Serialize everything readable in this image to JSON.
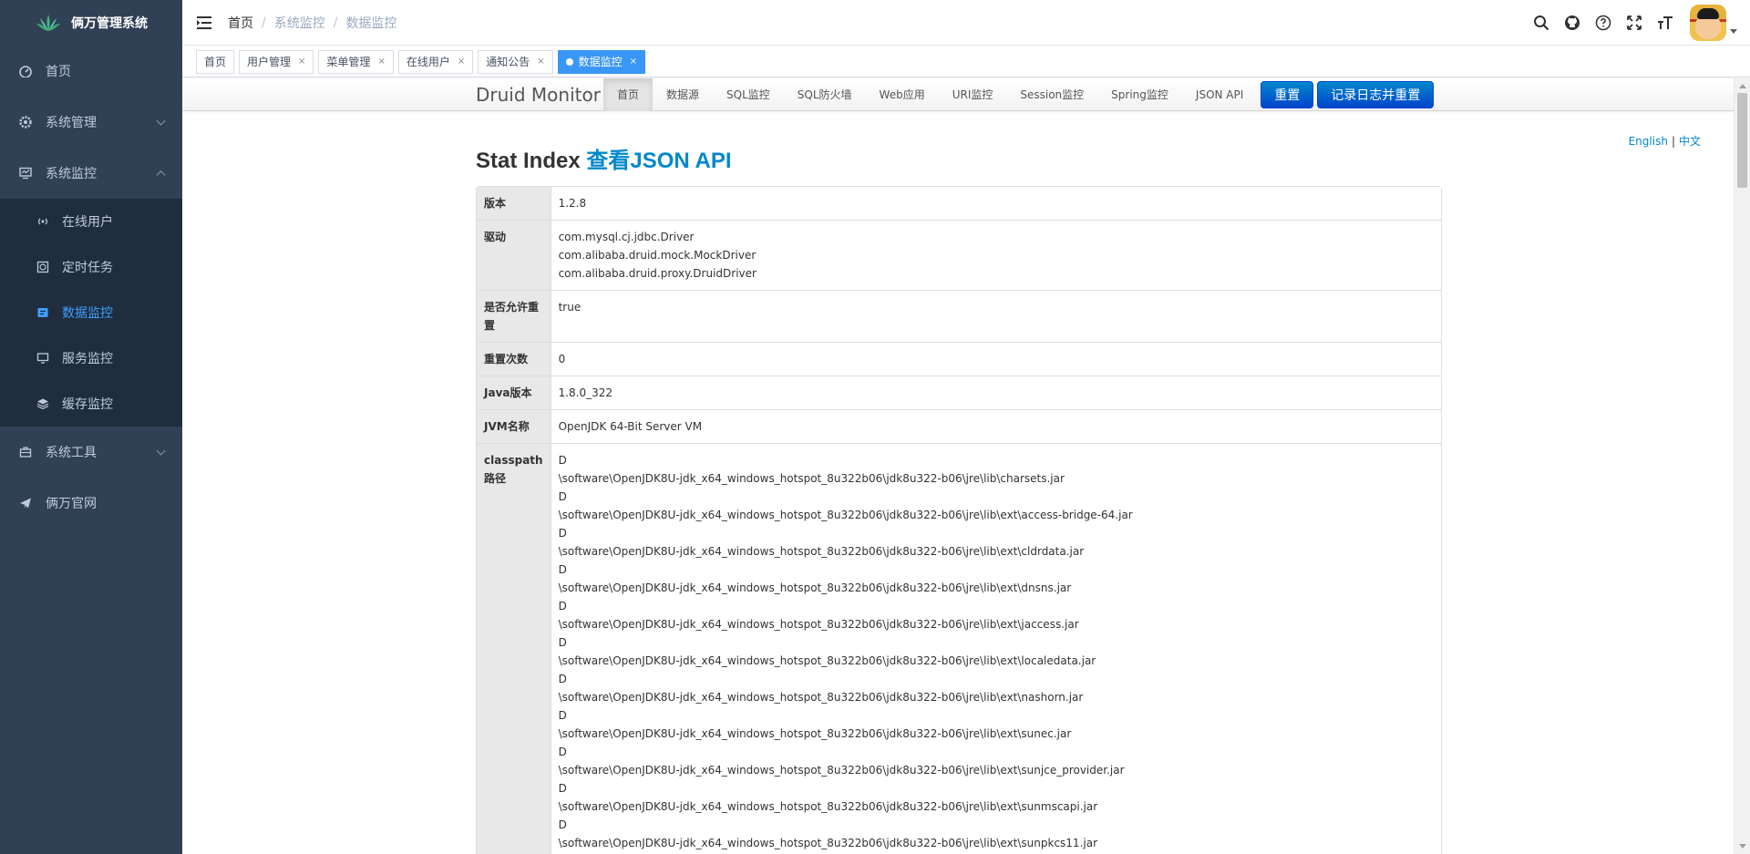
{
  "sidebar": {
    "logo_text": "俩万管理系统",
    "menu": [
      {
        "label": "首页",
        "icon": "dashboard-icon"
      },
      {
        "label": "系统管理",
        "icon": "gear-icon"
      },
      {
        "label": "系统监控",
        "icon": "monitor-icon"
      },
      {
        "label": "系统工具",
        "icon": "toolbox-icon"
      },
      {
        "label": "俩万官网",
        "icon": "paper-plane-icon"
      }
    ],
    "monitor_sub": [
      {
        "label": "在线用户",
        "icon": "online-icon"
      },
      {
        "label": "定时任务",
        "icon": "job-icon"
      },
      {
        "label": "数据监控",
        "icon": "druid-icon",
        "active": true
      },
      {
        "label": "服务监控",
        "icon": "server-icon"
      },
      {
        "label": "缓存监控",
        "icon": "redis-icon"
      }
    ]
  },
  "navbar": {
    "breadcrumb": [
      "首页",
      "系统监控",
      "数据监控"
    ]
  },
  "tags": [
    {
      "label": "首页"
    },
    {
      "label": "用户管理"
    },
    {
      "label": "菜单管理"
    },
    {
      "label": "在线用户"
    },
    {
      "label": "通知公告"
    },
    {
      "label": "数据监控",
      "active": true
    }
  ],
  "druid": {
    "brand": "Druid Monitor",
    "nav": [
      "首页",
      "数据源",
      "SQL监控",
      "SQL防火墙",
      "Web应用",
      "URI监控",
      "Session监控",
      "Spring监控",
      "JSON API"
    ],
    "reset_btn": "重置",
    "log_reset_btn": "记录日志并重置",
    "lang_en": "English",
    "lang_sep": "|",
    "lang_zh": "中文",
    "heading": "Stat Index",
    "heading_link": "查看JSON API",
    "rows": [
      {
        "key": "版本",
        "values": [
          "1.2.8"
        ]
      },
      {
        "key": "驱动",
        "values": [
          "com.mysql.cj.jdbc.Driver",
          "com.alibaba.druid.mock.MockDriver",
          "com.alibaba.druid.proxy.DruidDriver"
        ]
      },
      {
        "key": "是否允许重置",
        "values": [
          "true"
        ]
      },
      {
        "key": "重置次数",
        "values": [
          "0"
        ]
      },
      {
        "key": "Java版本",
        "values": [
          "1.8.0_322"
        ]
      },
      {
        "key": "JVM名称",
        "values": [
          "OpenJDK 64-Bit Server VM"
        ]
      },
      {
        "key": "classpath路径",
        "values": [
          "D",
          "\\software\\OpenJDK8U-jdk_x64_windows_hotspot_8u322b06\\jdk8u322-b06\\jre\\lib\\charsets.jar",
          "D",
          "\\software\\OpenJDK8U-jdk_x64_windows_hotspot_8u322b06\\jdk8u322-b06\\jre\\lib\\ext\\access-bridge-64.jar",
          "D",
          "\\software\\OpenJDK8U-jdk_x64_windows_hotspot_8u322b06\\jdk8u322-b06\\jre\\lib\\ext\\cldrdata.jar",
          "D",
          "\\software\\OpenJDK8U-jdk_x64_windows_hotspot_8u322b06\\jdk8u322-b06\\jre\\lib\\ext\\dnsns.jar",
          "D",
          "\\software\\OpenJDK8U-jdk_x64_windows_hotspot_8u322b06\\jdk8u322-b06\\jre\\lib\\ext\\jaccess.jar",
          "D",
          "\\software\\OpenJDK8U-jdk_x64_windows_hotspot_8u322b06\\jdk8u322-b06\\jre\\lib\\ext\\localedata.jar",
          "D",
          "\\software\\OpenJDK8U-jdk_x64_windows_hotspot_8u322b06\\jdk8u322-b06\\jre\\lib\\ext\\nashorn.jar",
          "D",
          "\\software\\OpenJDK8U-jdk_x64_windows_hotspot_8u322b06\\jdk8u322-b06\\jre\\lib\\ext\\sunec.jar",
          "D",
          "\\software\\OpenJDK8U-jdk_x64_windows_hotspot_8u322b06\\jdk8u322-b06\\jre\\lib\\ext\\sunjce_provider.jar",
          "D",
          "\\software\\OpenJDK8U-jdk_x64_windows_hotspot_8u322b06\\jdk8u322-b06\\jre\\lib\\ext\\sunmscapi.jar",
          "D",
          "\\software\\OpenJDK8U-jdk_x64_windows_hotspot_8u322b06\\jdk8u322-b06\\jre\\lib\\ext\\sunpkcs11.jar"
        ]
      }
    ]
  },
  "colors": {
    "sidebar_bg": "#304156",
    "submenu_bg": "#1f2d3d",
    "active_blue": "#409eff",
    "link_blue": "#0088cc"
  }
}
